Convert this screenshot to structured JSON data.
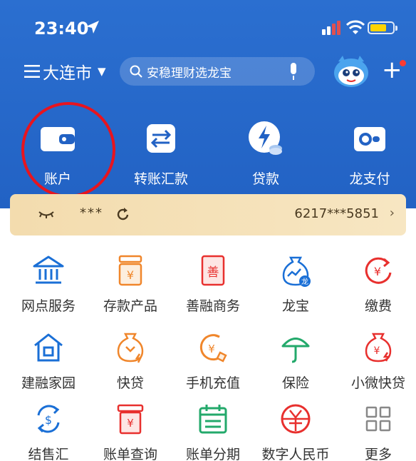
{
  "status_bar": {
    "time": "23:40"
  },
  "header": {
    "city": "大连市",
    "search_placeholder": "安稳理财选龙宝"
  },
  "quick_actions": [
    {
      "label": "账户",
      "icon": "wallet-icon"
    },
    {
      "label": "转账汇款",
      "icon": "transfer-icon"
    },
    {
      "label": "贷款",
      "icon": "loan-icon"
    },
    {
      "label": "龙支付",
      "icon": "long-pay-icon"
    }
  ],
  "account_card": {
    "masked_balance": "***",
    "account_number": "6217***5851",
    "chevron": "›"
  },
  "services": [
    {
      "label": "网点服务",
      "icon": "bank-branch-icon",
      "color": "#1a6fd6"
    },
    {
      "label": "存款产品",
      "icon": "deposit-icon",
      "color": "#f0862b"
    },
    {
      "label": "善融商务",
      "icon": "shanrong-icon",
      "color": "#e8302e"
    },
    {
      "label": "龙宝",
      "icon": "longbao-icon",
      "color": "#1a6fd6"
    },
    {
      "label": "缴费",
      "icon": "payment-icon",
      "color": "#e8302e"
    },
    {
      "label": "建融家园",
      "icon": "home-icon",
      "color": "#1a6fd6"
    },
    {
      "label": "快贷",
      "icon": "quick-loan-icon",
      "color": "#f0862b"
    },
    {
      "label": "手机充值",
      "icon": "phone-topup-icon",
      "color": "#f0862b"
    },
    {
      "label": "保险",
      "icon": "umbrella-icon",
      "color": "#23a96b"
    },
    {
      "label": "小微快贷",
      "icon": "micro-loan-icon",
      "color": "#e8302e"
    },
    {
      "label": "结售汇",
      "icon": "fx-exchange-icon",
      "color": "#1a6fd6"
    },
    {
      "label": "账单查询",
      "icon": "bill-query-icon",
      "color": "#e8302e"
    },
    {
      "label": "账单分期",
      "icon": "calendar-icon",
      "color": "#23a96b"
    },
    {
      "label": "数字人民币",
      "icon": "digital-rmb-icon",
      "color": "#e8302e"
    },
    {
      "label": "更多",
      "icon": "more-grid-icon",
      "color": "#888888"
    }
  ],
  "colors": {
    "header_blue": "#2262c4",
    "highlight_red": "#e8141e",
    "card_gold": "#f3dcae"
  }
}
